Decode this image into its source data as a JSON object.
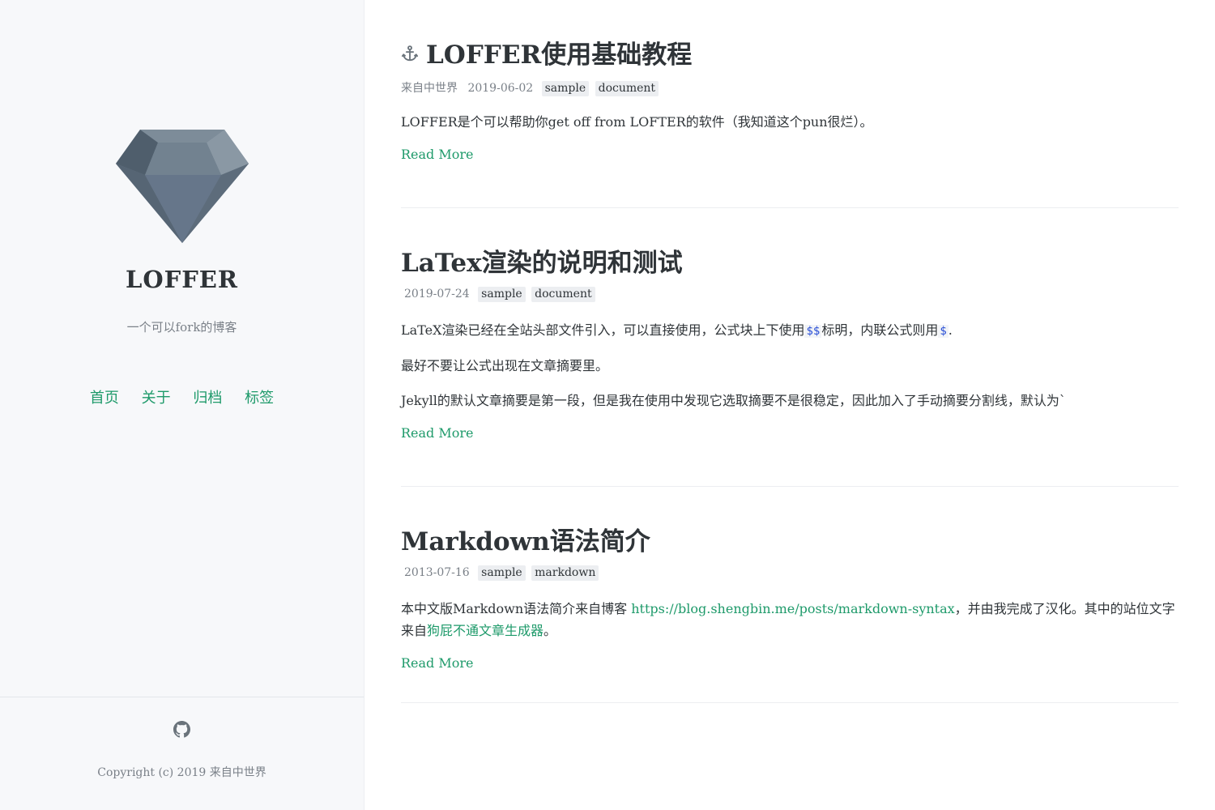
{
  "sidebar": {
    "title": "LOFFER",
    "description": "一个可以fork的博客",
    "nav": [
      "首页",
      "关于",
      "归档",
      "标签"
    ],
    "logo_icon": "diamond-icon",
    "github_icon": "github-icon",
    "copyright": "Copyright (c) 2019 来自中世界"
  },
  "posts": [
    {
      "title": "LOFFER使用基础教程",
      "pinned_icon": "anchor-icon",
      "author": "来自中世界",
      "date": "2019-06-02",
      "tags": [
        "sample",
        "document"
      ],
      "excerpt": [
        "LOFFER是个可以帮助你get off from LOFTER的软件（我知道这个pun很烂）。"
      ],
      "read_more": "Read More"
    },
    {
      "title": "LaTex渲染的说明和测试",
      "date": "2019-07-24",
      "tags": [
        "sample",
        "document"
      ],
      "excerpt_p1_a": "LaTeX渲染已经在全站头部文件引入，可以直接使用，公式块上下使用",
      "excerpt_p1_code1": "$$",
      "excerpt_p1_b": "标明，内联公式则用",
      "excerpt_p1_code2": "$",
      "excerpt_p1_c": ".",
      "excerpt_p2": "最好不要让公式出现在文章摘要里。",
      "excerpt_p3": "Jekyll的默认文章摘要是第一段，但是我在使用中发现它选取摘要不是很稳定，因此加入了手动摘要分割线，默认为`",
      "read_more": "Read More"
    },
    {
      "title": "Markdown语法简介",
      "date": "2013-07-16",
      "tags": [
        "sample",
        "markdown"
      ],
      "excerpt_a": "本中文版Markdown语法简介来自博客 ",
      "excerpt_link1": "https://blog.shengbin.me/posts/markdown-syntax",
      "excerpt_b": "，并由我完成了汉化。其中的站位文字来自",
      "excerpt_link2": "狗屁不通文章生成器",
      "excerpt_c": "。",
      "read_more": "Read More"
    }
  ],
  "colors": {
    "accent": "#1e9a6a",
    "sidebar_bg": "#f7f8fa",
    "code": "#2a4fd6"
  }
}
